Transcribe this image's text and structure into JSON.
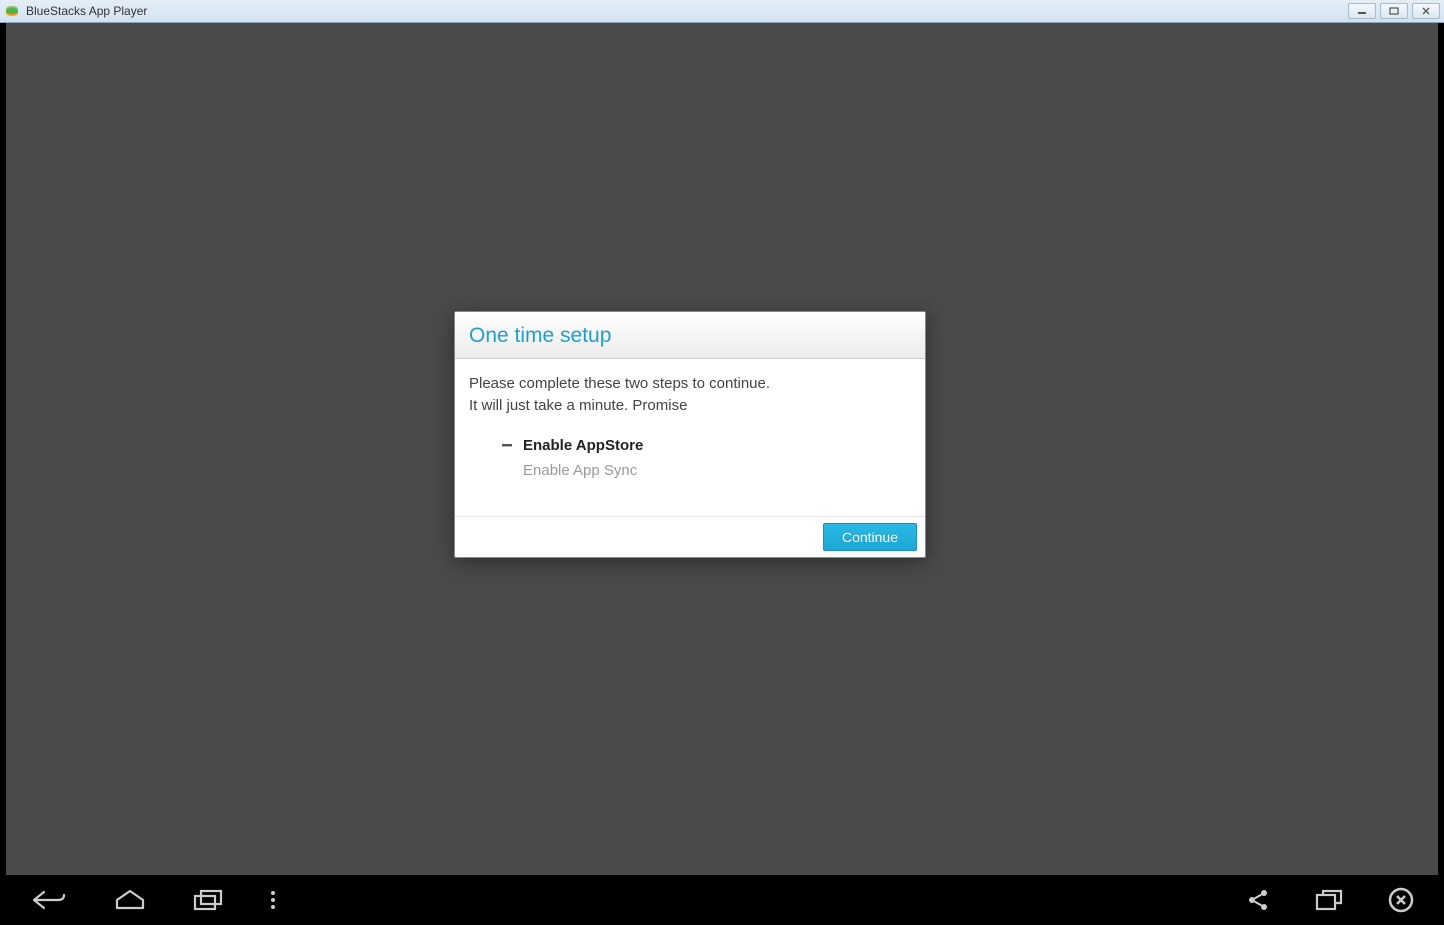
{
  "window": {
    "title": "BlueStacks App Player"
  },
  "dialog": {
    "title": "One time setup",
    "message_line1": "Please complete these two steps to continue.",
    "message_line2": "It will just take a minute. Promise",
    "steps": {
      "current": "Enable AppStore",
      "pending": "Enable App Sync"
    },
    "continue_label": "Continue"
  }
}
